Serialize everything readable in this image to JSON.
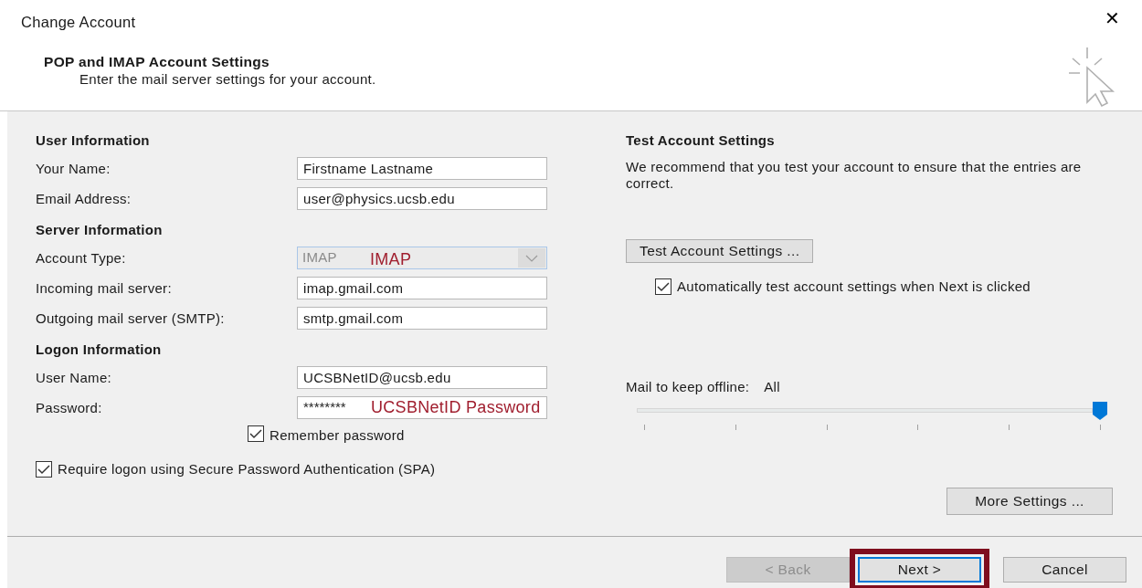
{
  "window": {
    "title": "Change Account",
    "close": "✕"
  },
  "header": {
    "title": "POP and IMAP Account Settings",
    "subtitle": "Enter the mail server settings for your account."
  },
  "sections": [
    {
      "heading": "User Information",
      "fields": [
        {
          "kind": "text",
          "label": "Your Name:",
          "value": "Firstname Lastname"
        },
        {
          "kind": "text",
          "label": "Email Address:",
          "value": "user@physics.ucsb.edu"
        }
      ]
    },
    {
      "heading": "Server Information",
      "fields": [
        {
          "kind": "dropdown",
          "label": "Account Type:",
          "value": "IMAP",
          "disabled": true,
          "annotation": "IMAP"
        },
        {
          "kind": "text",
          "label": "Incoming mail server:",
          "value": "imap.gmail.com"
        },
        {
          "kind": "text",
          "label": "Outgoing mail server (SMTP):",
          "value": "smtp.gmail.com"
        }
      ]
    },
    {
      "heading": "Logon Information",
      "fields": [
        {
          "kind": "text",
          "label": "User Name:",
          "value": "UCSBNetID@ucsb.edu"
        },
        {
          "kind": "password",
          "label": "Password:",
          "value": "********",
          "annotation": "UCSBNetID Password"
        }
      ]
    }
  ],
  "remember_password": {
    "label": "Remember password",
    "checked": true
  },
  "require_spa": {
    "label": "Require logon using Secure Password Authentication (SPA)",
    "checked": true
  },
  "test": {
    "heading": "Test Account Settings",
    "description": "We recommend that you test your account to ensure that the entries are correct.",
    "button": "Test Account Settings ...",
    "auto_test": {
      "label": "Automatically test account settings when Next is clicked",
      "checked": true
    }
  },
  "offline": {
    "label": "Mail to keep offline:",
    "value": "All",
    "level": 1.0
  },
  "more_settings": "More Settings ...",
  "footer_buttons": [
    {
      "label": "< Back",
      "disabled": true,
      "default": false,
      "highlighted": false
    },
    {
      "label": "Next >",
      "disabled": false,
      "default": true,
      "highlighted": true
    },
    {
      "label": "Cancel",
      "disabled": false,
      "default": false,
      "highlighted": false
    }
  ]
}
